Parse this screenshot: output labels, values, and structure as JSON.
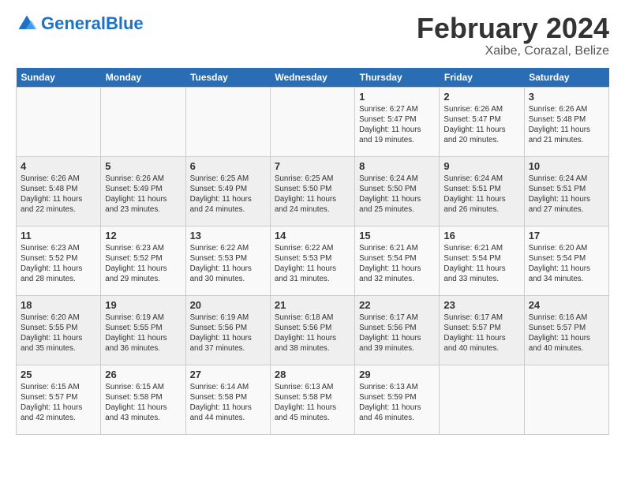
{
  "header": {
    "logo_general": "General",
    "logo_blue": "Blue",
    "title": "February 2024",
    "subtitle": "Xaibe, Corazal, Belize"
  },
  "weekdays": [
    "Sunday",
    "Monday",
    "Tuesday",
    "Wednesday",
    "Thursday",
    "Friday",
    "Saturday"
  ],
  "weeks": [
    [
      {
        "day": "",
        "info": ""
      },
      {
        "day": "",
        "info": ""
      },
      {
        "day": "",
        "info": ""
      },
      {
        "day": "",
        "info": ""
      },
      {
        "day": "1",
        "info": "Sunrise: 6:27 AM\nSunset: 5:47 PM\nDaylight: 11 hours and 19 minutes."
      },
      {
        "day": "2",
        "info": "Sunrise: 6:26 AM\nSunset: 5:47 PM\nDaylight: 11 hours and 20 minutes."
      },
      {
        "day": "3",
        "info": "Sunrise: 6:26 AM\nSunset: 5:48 PM\nDaylight: 11 hours and 21 minutes."
      }
    ],
    [
      {
        "day": "4",
        "info": "Sunrise: 6:26 AM\nSunset: 5:48 PM\nDaylight: 11 hours and 22 minutes."
      },
      {
        "day": "5",
        "info": "Sunrise: 6:26 AM\nSunset: 5:49 PM\nDaylight: 11 hours and 23 minutes."
      },
      {
        "day": "6",
        "info": "Sunrise: 6:25 AM\nSunset: 5:49 PM\nDaylight: 11 hours and 24 minutes."
      },
      {
        "day": "7",
        "info": "Sunrise: 6:25 AM\nSunset: 5:50 PM\nDaylight: 11 hours and 24 minutes."
      },
      {
        "day": "8",
        "info": "Sunrise: 6:24 AM\nSunset: 5:50 PM\nDaylight: 11 hours and 25 minutes."
      },
      {
        "day": "9",
        "info": "Sunrise: 6:24 AM\nSunset: 5:51 PM\nDaylight: 11 hours and 26 minutes."
      },
      {
        "day": "10",
        "info": "Sunrise: 6:24 AM\nSunset: 5:51 PM\nDaylight: 11 hours and 27 minutes."
      }
    ],
    [
      {
        "day": "11",
        "info": "Sunrise: 6:23 AM\nSunset: 5:52 PM\nDaylight: 11 hours and 28 minutes."
      },
      {
        "day": "12",
        "info": "Sunrise: 6:23 AM\nSunset: 5:52 PM\nDaylight: 11 hours and 29 minutes."
      },
      {
        "day": "13",
        "info": "Sunrise: 6:22 AM\nSunset: 5:53 PM\nDaylight: 11 hours and 30 minutes."
      },
      {
        "day": "14",
        "info": "Sunrise: 6:22 AM\nSunset: 5:53 PM\nDaylight: 11 hours and 31 minutes."
      },
      {
        "day": "15",
        "info": "Sunrise: 6:21 AM\nSunset: 5:54 PM\nDaylight: 11 hours and 32 minutes."
      },
      {
        "day": "16",
        "info": "Sunrise: 6:21 AM\nSunset: 5:54 PM\nDaylight: 11 hours and 33 minutes."
      },
      {
        "day": "17",
        "info": "Sunrise: 6:20 AM\nSunset: 5:54 PM\nDaylight: 11 hours and 34 minutes."
      }
    ],
    [
      {
        "day": "18",
        "info": "Sunrise: 6:20 AM\nSunset: 5:55 PM\nDaylight: 11 hours and 35 minutes."
      },
      {
        "day": "19",
        "info": "Sunrise: 6:19 AM\nSunset: 5:55 PM\nDaylight: 11 hours and 36 minutes."
      },
      {
        "day": "20",
        "info": "Sunrise: 6:19 AM\nSunset: 5:56 PM\nDaylight: 11 hours and 37 minutes."
      },
      {
        "day": "21",
        "info": "Sunrise: 6:18 AM\nSunset: 5:56 PM\nDaylight: 11 hours and 38 minutes."
      },
      {
        "day": "22",
        "info": "Sunrise: 6:17 AM\nSunset: 5:56 PM\nDaylight: 11 hours and 39 minutes."
      },
      {
        "day": "23",
        "info": "Sunrise: 6:17 AM\nSunset: 5:57 PM\nDaylight: 11 hours and 40 minutes."
      },
      {
        "day": "24",
        "info": "Sunrise: 6:16 AM\nSunset: 5:57 PM\nDaylight: 11 hours and 40 minutes."
      }
    ],
    [
      {
        "day": "25",
        "info": "Sunrise: 6:15 AM\nSunset: 5:57 PM\nDaylight: 11 hours and 42 minutes."
      },
      {
        "day": "26",
        "info": "Sunrise: 6:15 AM\nSunset: 5:58 PM\nDaylight: 11 hours and 43 minutes."
      },
      {
        "day": "27",
        "info": "Sunrise: 6:14 AM\nSunset: 5:58 PM\nDaylight: 11 hours and 44 minutes."
      },
      {
        "day": "28",
        "info": "Sunrise: 6:13 AM\nSunset: 5:58 PM\nDaylight: 11 hours and 45 minutes."
      },
      {
        "day": "29",
        "info": "Sunrise: 6:13 AM\nSunset: 5:59 PM\nDaylight: 11 hours and 46 minutes."
      },
      {
        "day": "",
        "info": ""
      },
      {
        "day": "",
        "info": ""
      }
    ]
  ]
}
